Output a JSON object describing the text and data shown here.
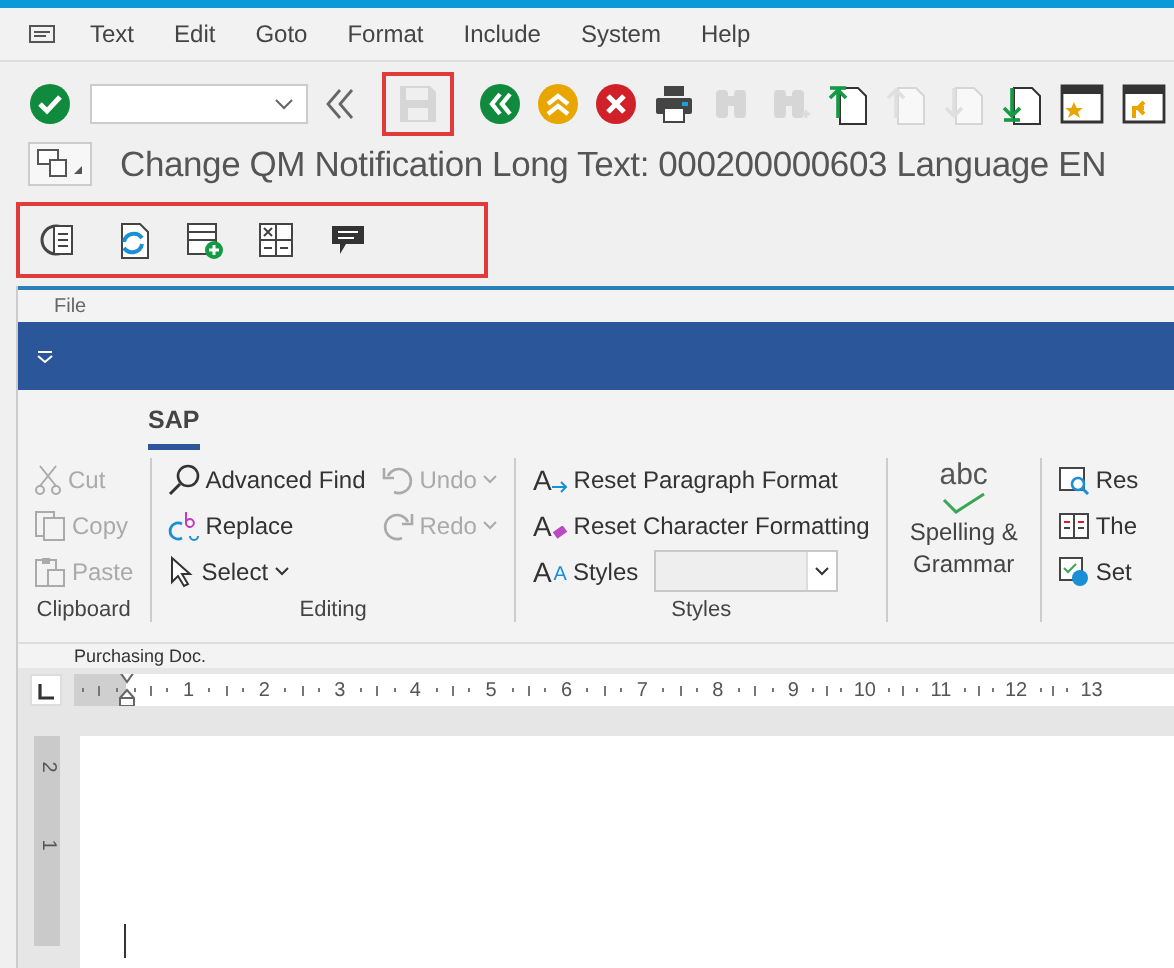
{
  "menu_bar": {
    "items": [
      {
        "label": "Text"
      },
      {
        "label": "Edit"
      },
      {
        "label": "Goto"
      },
      {
        "label": "Format"
      },
      {
        "label": "Include"
      },
      {
        "label": "System"
      },
      {
        "label": "Help"
      }
    ]
  },
  "toolbar": [
    {
      "kind": "enter",
      "disabled": false,
      "highlighted": false
    },
    {
      "kind": "command-field",
      "disabled": false,
      "highlighted": false
    },
    {
      "kind": "collapse",
      "disabled": false,
      "highlighted": false
    },
    {
      "kind": "save",
      "disabled": true,
      "highlighted": true
    },
    {
      "kind": "back",
      "disabled": false,
      "highlighted": false
    },
    {
      "kind": "exit",
      "disabled": false,
      "highlighted": false
    },
    {
      "kind": "cancel",
      "disabled": false,
      "highlighted": false
    },
    {
      "kind": "print",
      "disabled": false,
      "highlighted": false
    },
    {
      "kind": "find",
      "disabled": true,
      "highlighted": false
    },
    {
      "kind": "find-next",
      "disabled": true,
      "highlighted": false
    },
    {
      "kind": "first-page",
      "disabled": false,
      "highlighted": false
    },
    {
      "kind": "previous-page",
      "disabled": true,
      "highlighted": false
    },
    {
      "kind": "next-page",
      "disabled": true,
      "highlighted": false
    },
    {
      "kind": "last-page",
      "disabled": false,
      "highlighted": false
    },
    {
      "kind": "bookmark",
      "disabled": false,
      "highlighted": false
    },
    {
      "kind": "shortcut",
      "disabled": false,
      "highlighted": false
    }
  ],
  "title": "Change QM Notification Long Text: 000200000603 Language EN",
  "app_toolbar": {
    "highlighted": true,
    "items": [
      {
        "kind": "document"
      },
      {
        "kind": "refresh"
      },
      {
        "kind": "insert"
      },
      {
        "kind": "formula"
      },
      {
        "kind": "comment"
      }
    ]
  },
  "editor": {
    "file_menu": "File",
    "tab": {
      "label": "SAP",
      "selected": true
    },
    "groups": [
      {
        "label": "Clipboard",
        "columns": [
          [
            {
              "kind": "cut",
              "label": "Cut",
              "disabled": true,
              "dropdown": false
            },
            {
              "kind": "copy",
              "label": "Copy",
              "disabled": true,
              "dropdown": false
            },
            {
              "kind": "paste",
              "label": "Paste",
              "disabled": true,
              "dropdown": false
            }
          ]
        ]
      },
      {
        "label": "Editing",
        "columns": [
          [
            {
              "kind": "find",
              "label": "Advanced Find",
              "disabled": false,
              "dropdown": false
            },
            {
              "kind": "replace",
              "label": "Replace",
              "disabled": false,
              "dropdown": false
            },
            {
              "kind": "select",
              "label": "Select",
              "disabled": false,
              "dropdown": true
            }
          ],
          [
            {
              "kind": "undo",
              "label": "Undo",
              "disabled": true,
              "dropdown": true
            },
            {
              "kind": "redo",
              "label": "Redo",
              "disabled": true,
              "dropdown": true
            }
          ]
        ]
      },
      {
        "label": "Styles",
        "columns": [
          [
            {
              "kind": "reset-paragraph",
              "icon_letters": [
                "A"
              ],
              "label": "Reset Paragraph Format",
              "disabled": false,
              "dropdown": false
            },
            {
              "kind": "reset-character",
              "icon_letters": [
                "A"
              ],
              "label": "Reset Character Formatting",
              "disabled": false,
              "dropdown": false
            },
            {
              "kind": "styles",
              "icon_letters": [
                "A",
                "A"
              ],
              "label": "Styles",
              "disabled": false,
              "dropdown": false,
              "combo": true
            }
          ]
        ]
      },
      {
        "big": {
          "kind": "spelling",
          "icon_text": "abc",
          "label": "Spelling & Grammar"
        }
      },
      {
        "columns": [
          [
            {
              "kind": "research",
              "label": "Res",
              "disabled": false,
              "dropdown": false
            },
            {
              "kind": "thesaurus",
              "label": "The",
              "disabled": false,
              "dropdown": false
            },
            {
              "kind": "language",
              "label": "Set",
              "disabled": false,
              "dropdown": false
            }
          ]
        ]
      }
    ],
    "background_text": "Purchasing Doc.",
    "ruler": [
      "1",
      "2",
      "3",
      "4",
      "5",
      "6",
      "7",
      "8",
      "9",
      "10",
      "11",
      "12",
      "13"
    ],
    "vertical_ruler": [
      "2",
      "1"
    ]
  }
}
